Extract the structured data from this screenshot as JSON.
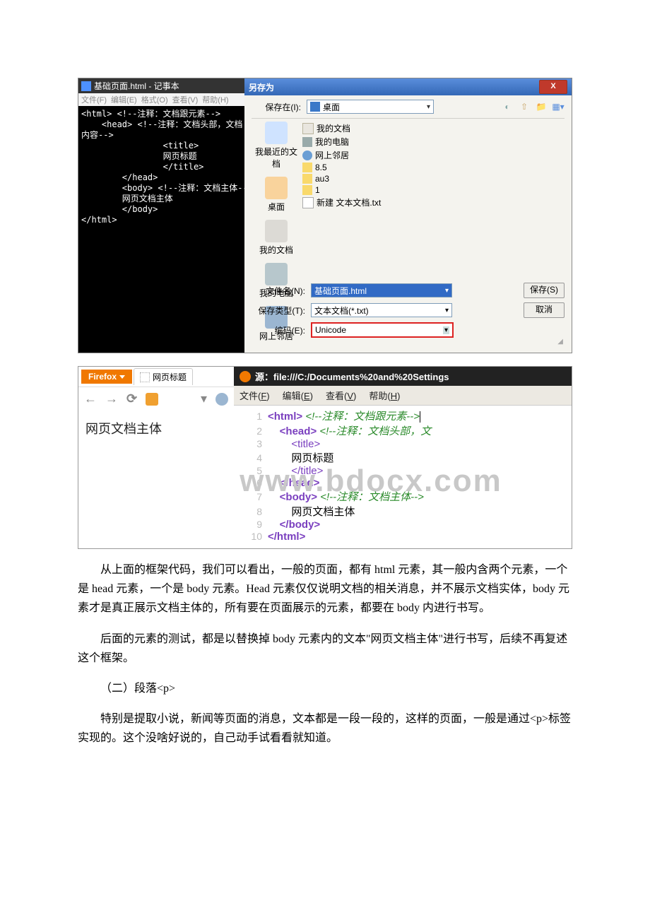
{
  "notepad": {
    "title": "基础页面.html - 记事本",
    "menus": [
      "文件(F)",
      "编辑(E)",
      "格式(O)",
      "查看(V)",
      "帮助(H)"
    ],
    "lines": [
      "<html> <!--注释：文档跟元素-->",
      "    <head> <!--注释：文档头部，文档",
      "内容-->",
      "                <title>",
      "                网页标题",
      "                </title>",
      "        </head>",
      "        <body> <!--注释：文档主体--",
      "        网页文档主体",
      "        </body>",
      "</html>"
    ]
  },
  "saveas": {
    "title": "另存为",
    "close": "X",
    "save_in_label": "保存在(I):",
    "save_in_value": "桌面",
    "tool_back": "后退",
    "tool_up": "向上一级",
    "tool_new": "新建文件夹",
    "tool_view": "视图",
    "places": [
      "我最近的文档",
      "桌面",
      "我的文档",
      "我的电脑",
      "网上邻居"
    ],
    "items": [
      {
        "icon": "doc",
        "label": "我的文档"
      },
      {
        "icon": "pc",
        "label": "我的电脑"
      },
      {
        "icon": "net",
        "label": "网上邻居"
      },
      {
        "icon": "fld",
        "label": "8.5"
      },
      {
        "icon": "fld",
        "label": "au3"
      },
      {
        "icon": "fld",
        "label": "1"
      },
      {
        "icon": "txt",
        "label": "新建 文本文档.txt"
      }
    ],
    "filename_label": "文件名(N):",
    "filename_value": "基础页面.html",
    "filetype_label": "保存类型(T):",
    "filetype_value": "文本文档(*.txt)",
    "encoding_label": "编码(E):",
    "encoding_value": "Unicode",
    "save_btn": "保存(S)",
    "cancel_btn": "取消"
  },
  "firefox": {
    "brand": "Firefox",
    "tab_title": "网页标题",
    "body_text": "网页文档主体",
    "src_title": "源：file:///C:/Documents%20and%20Settings",
    "src_menus": [
      {
        "t": "文件(",
        "u": "F",
        "r": ")"
      },
      {
        "t": "编辑(",
        "u": "E",
        "r": ")"
      },
      {
        "t": "查看(",
        "u": "V",
        "r": ")"
      },
      {
        "t": "帮助(",
        "u": "H",
        "r": ")"
      }
    ],
    "code": [
      {
        "n": "1",
        "seg": [
          {
            "c": "tagb",
            "t": "<html>"
          },
          {
            "c": "txt",
            "t": " "
          },
          {
            "c": "com",
            "t": "<!--注释：文档跟元素-->"
          }
        ]
      },
      {
        "n": "2",
        "seg": [
          {
            "c": "txt",
            "t": "    "
          },
          {
            "c": "tagb",
            "t": "<head>"
          },
          {
            "c": "txt",
            "t": " "
          },
          {
            "c": "com",
            "t": "<!--注释：文档头部，文"
          }
        ]
      },
      {
        "n": "3",
        "seg": [
          {
            "c": "txt",
            "t": "        "
          },
          {
            "c": "tag",
            "t": "<title>"
          }
        ]
      },
      {
        "n": "4",
        "seg": [
          {
            "c": "txt",
            "t": "        "
          },
          {
            "c": "txt",
            "t": "网页标题"
          }
        ]
      },
      {
        "n": "5",
        "seg": [
          {
            "c": "txt",
            "t": "        "
          },
          {
            "c": "tag",
            "t": "</title>"
          }
        ]
      },
      {
        "n": "6",
        "seg": [
          {
            "c": "txt",
            "t": "    "
          },
          {
            "c": "tagb",
            "t": "</head>"
          }
        ]
      },
      {
        "n": "7",
        "seg": [
          {
            "c": "txt",
            "t": "    "
          },
          {
            "c": "tagb",
            "t": "<body>"
          },
          {
            "c": "txt",
            "t": " "
          },
          {
            "c": "com",
            "t": "<!--注释：文档主体-->"
          }
        ]
      },
      {
        "n": "8",
        "seg": [
          {
            "c": "txt",
            "t": "        网页文档主体"
          }
        ]
      },
      {
        "n": "9",
        "seg": [
          {
            "c": "txt",
            "t": "    "
          },
          {
            "c": "tagb",
            "t": "</body>"
          }
        ]
      },
      {
        "n": "10",
        "seg": [
          {
            "c": "tagb",
            "t": "</html>"
          }
        ]
      }
    ]
  },
  "article": {
    "p1": "从上面的框架代码，我们可以看出，一般的页面，都有 html 元素，其一般内含两个元素，一个是 head 元素，一个是 body 元素。Head 元素仅仅说明文档的相关消息，并不展示文档实体，body 元素才是真正展示文档主体的，所有要在页面展示的元素，都要在 body 内进行书写。",
    "p2": "后面的元素的测试，都是以替换掉 body 元素内的文本\"网页文档主体\"进行书写，后续不再复述这个框架。",
    "p3": "（二）段落<p>",
    "p4": "特别是提取小说，新闻等页面的消息，文本都是一段一段的，这样的页面，一般是通过<p>标签实现的。这个没啥好说的，自己动手试看看就知道。"
  },
  "watermark": "www.bdocx.com"
}
